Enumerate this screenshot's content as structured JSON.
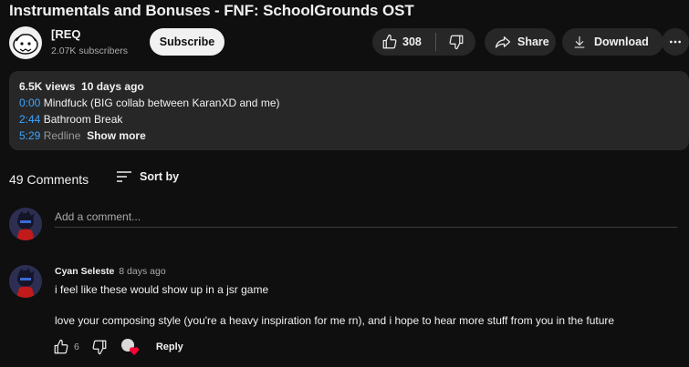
{
  "video": {
    "title": "Instrumentals and Bonuses - FNF: SchoolGrounds OST"
  },
  "channel": {
    "name": "[REQ",
    "subscribers": "2.07K subscribers",
    "subscribe_label": "Subscribe"
  },
  "actions": {
    "like_count": "308",
    "share_label": "Share",
    "download_label": "Download"
  },
  "description": {
    "views": "6.5K views",
    "date": "10 days ago",
    "lines": [
      {
        "time": "0:00",
        "text": " Mindfuck (BIG collab between KaranXD and me)"
      },
      {
        "time": "2:44",
        "text": " Bathroom Break"
      },
      {
        "time": "5:29",
        "text": " Redline"
      }
    ],
    "show_more": "Show more"
  },
  "comments_section": {
    "count_label": "49 Comments",
    "sort_label": "Sort by",
    "add_placeholder": "Add a comment..."
  },
  "comments": [
    {
      "author": "Cyan Seleste",
      "time": "8 days ago",
      "text_line1": "i feel like these would show up in a jsr game",
      "text_line2": "love your composing style (you're a heavy inspiration for me rn), and i hope to hear more stuff from you in the future",
      "likes": "6",
      "reply_label": "Reply"
    }
  ],
  "colors": {
    "background": "#0f0f0f",
    "surface": "#272727",
    "timestamp_link": "#3ea6ff",
    "heart": "#ff0033"
  }
}
